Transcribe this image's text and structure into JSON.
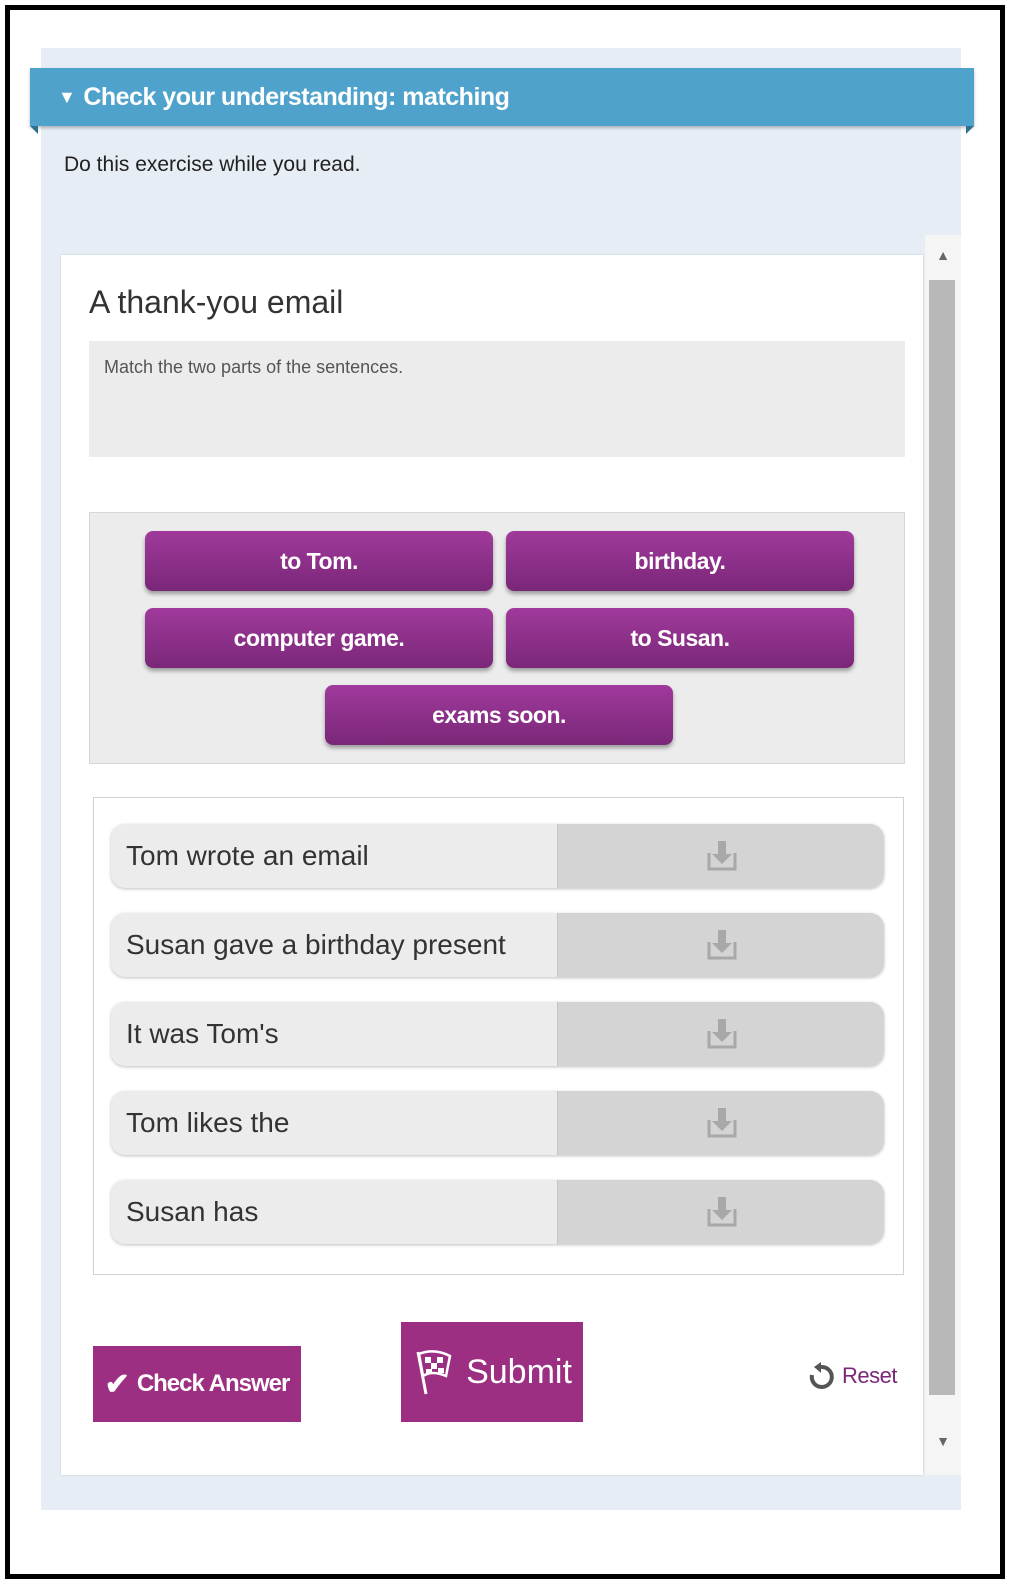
{
  "header": {
    "title": "Check your understanding: matching",
    "toggle_icon": "triangle-down-icon",
    "color": "#4fa2cc"
  },
  "intro_text": "Do this exercise while you read.",
  "exercise": {
    "title": "A thank-you email",
    "instruction": "Match the two parts of the sentences."
  },
  "answer_chips": [
    {
      "label": "to Tom."
    },
    {
      "label": "birthday."
    },
    {
      "label": "computer game."
    },
    {
      "label": "to Susan."
    },
    {
      "label": "exams soon."
    }
  ],
  "prompts": [
    {
      "label": "Tom wrote an email",
      "drop_icon": "drop-target-icon"
    },
    {
      "label": "Susan gave a birthday present",
      "drop_icon": "drop-target-icon"
    },
    {
      "label": "It was Tom's",
      "drop_icon": "drop-target-icon"
    },
    {
      "label": "Tom likes the",
      "drop_icon": "drop-target-icon"
    },
    {
      "label": "Susan has",
      "drop_icon": "drop-target-icon"
    }
  ],
  "actions": {
    "check_label": "Check Answer",
    "check_icon": "checkmark-icon",
    "submit_label": "Submit",
    "submit_icon": "checkered-flag-icon",
    "reset_label": "Reset",
    "reset_icon": "reset-icon"
  },
  "colors": {
    "accent": "#9c2f82",
    "chip_top": "#a03a9c",
    "chip_bottom": "#7a2778",
    "panel_bg": "#e6edf5"
  }
}
